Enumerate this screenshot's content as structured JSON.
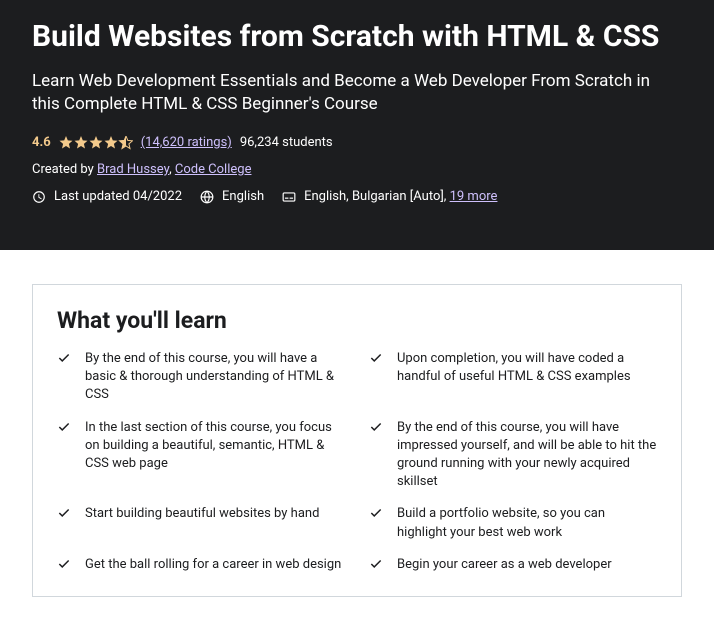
{
  "hero": {
    "title": "Build Websites from Scratch with HTML & CSS",
    "subtitle": "Learn Web Development Essentials and Become a Web Developer From Scratch in this Complete HTML & CSS Beginner's Course",
    "rating": "4.6",
    "ratings_count": "(14,620 ratings)",
    "students": "96,234 students",
    "created_by_label": "Created by ",
    "authors": [
      "Brad Hussey",
      "Code College"
    ],
    "author_separator": ", ",
    "last_updated": "Last updated 04/2022",
    "language": "English",
    "captions": "English, Bulgarian [Auto], ",
    "captions_more": "19 more"
  },
  "learn": {
    "heading": "What you'll learn",
    "items": [
      "By the end of this course, you will have a basic & thorough understanding of HTML & CSS",
      "Upon completion, you will have coded a handful of useful HTML & CSS examples",
      "In the last section of this course, you focus on building a beautiful, semantic, HTML & CSS web page",
      "By the end of this course, you will have impressed yourself, and will be able to hit the ground running with your newly acquired skillset",
      "Start building beautiful websites by hand",
      "Build a portfolio website, so you can highlight your best web work",
      "Get the ball rolling for a career in web design",
      "Begin your career as a web developer"
    ]
  }
}
